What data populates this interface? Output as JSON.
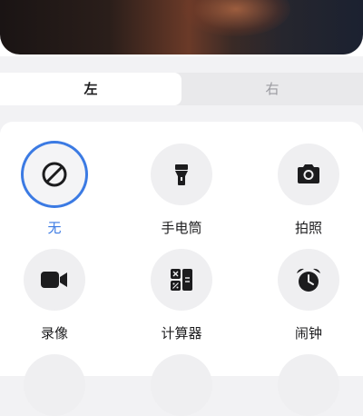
{
  "tabs": [
    {
      "label": "左",
      "selected": true
    },
    {
      "label": "右",
      "selected": false
    }
  ],
  "options": [
    {
      "label": "无",
      "icon": "none-icon",
      "selected": true
    },
    {
      "label": "手电筒",
      "icon": "flashlight-icon",
      "selected": false
    },
    {
      "label": "拍照",
      "icon": "camera-icon",
      "selected": false
    },
    {
      "label": "录像",
      "icon": "video-camera-icon",
      "selected": false
    },
    {
      "label": "计算器",
      "icon": "calculator-icon",
      "selected": false
    },
    {
      "label": "闹钟",
      "icon": "alarm-clock-icon",
      "selected": false
    }
  ],
  "colors": {
    "accent": "#3b7ae3",
    "icon": "#1c1c1e",
    "circle_bg": "#efeff1"
  }
}
